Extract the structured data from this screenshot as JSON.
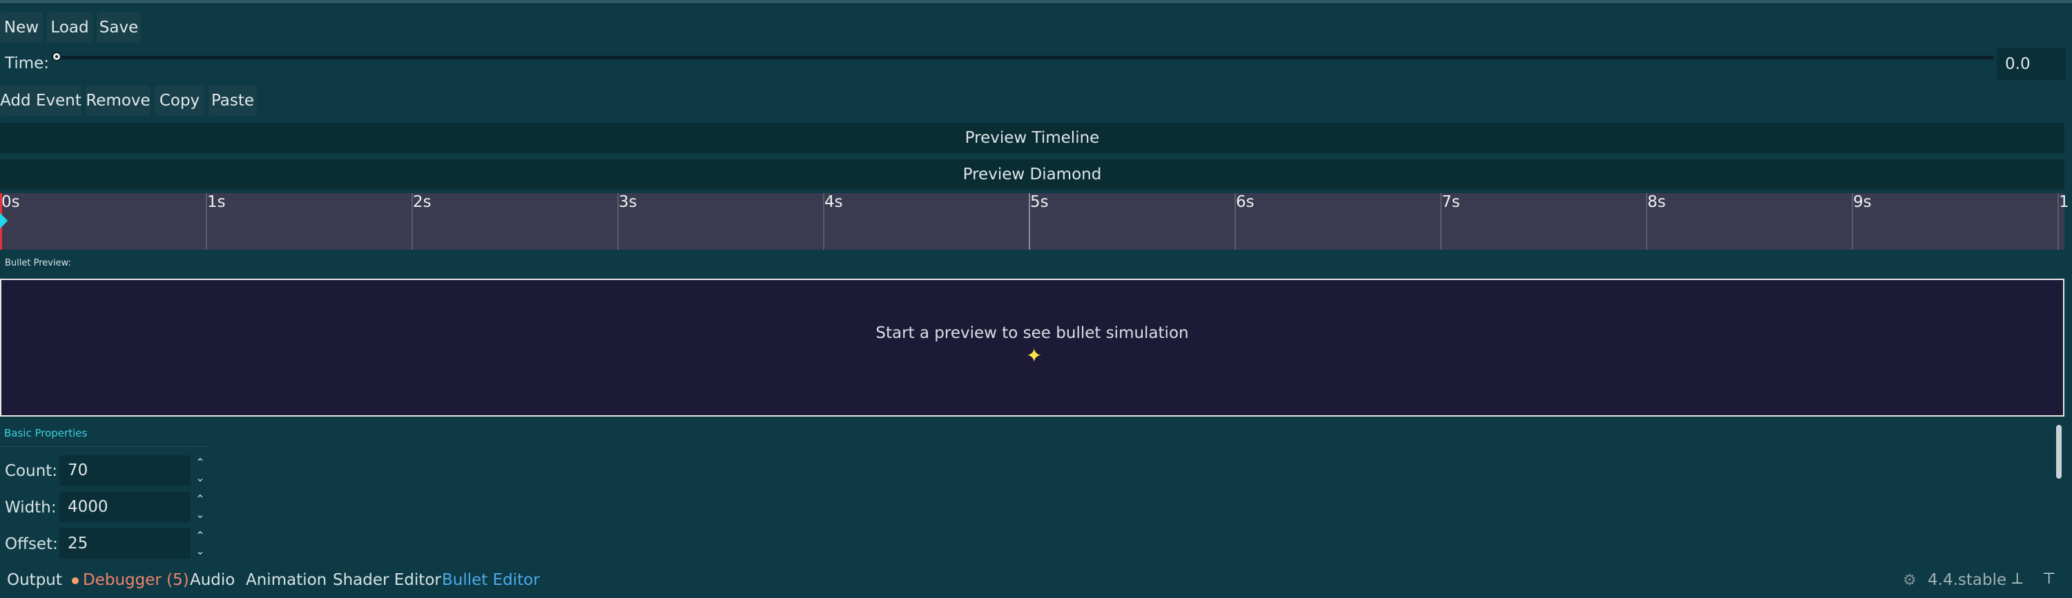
{
  "toolbar": {
    "new_label": "New",
    "load_label": "Load",
    "save_label": "Save"
  },
  "time": {
    "label": "Time:",
    "value": "0.0",
    "slider_fraction": 0.0
  },
  "events": {
    "add_label": "Add Event",
    "remove_label": "Remove",
    "copy_label": "Copy",
    "paste_label": "Paste"
  },
  "preview_timeline_label": "Preview Timeline",
  "preview_diamond_label": "Preview Diamond",
  "timeline": {
    "ticks": [
      "0s",
      "1s",
      "2s",
      "3s",
      "4s",
      "5s",
      "6s",
      "7s",
      "8s",
      "9s",
      "1"
    ]
  },
  "bullet_preview": {
    "label": "Bullet Preview:",
    "message": "Start a preview to see bullet simulation"
  },
  "basic_properties": {
    "title": "Basic Properties",
    "fields": [
      {
        "label": "Count:",
        "value": "70"
      },
      {
        "label": "Width:",
        "value": "4000"
      },
      {
        "label": "Offset:",
        "value": "25"
      }
    ]
  },
  "bottom_tabs": {
    "output": "Output",
    "debugger": "Debugger (5)",
    "audio": "Audio",
    "animation": "Animation",
    "shader_editor": "Shader Editor",
    "bullet_editor": "Bullet Editor"
  },
  "version": "4.4.stable",
  "colors": {
    "background": "#0e3a45",
    "accent": "#4ea9e8",
    "debugger": "#f0836c",
    "timeline": "#3a3a50",
    "preview": "#1c1a36"
  },
  "icons": {
    "pin": "pin-icon",
    "collapse": "collapse-panel-icon",
    "godot": "godot-logo-icon"
  }
}
